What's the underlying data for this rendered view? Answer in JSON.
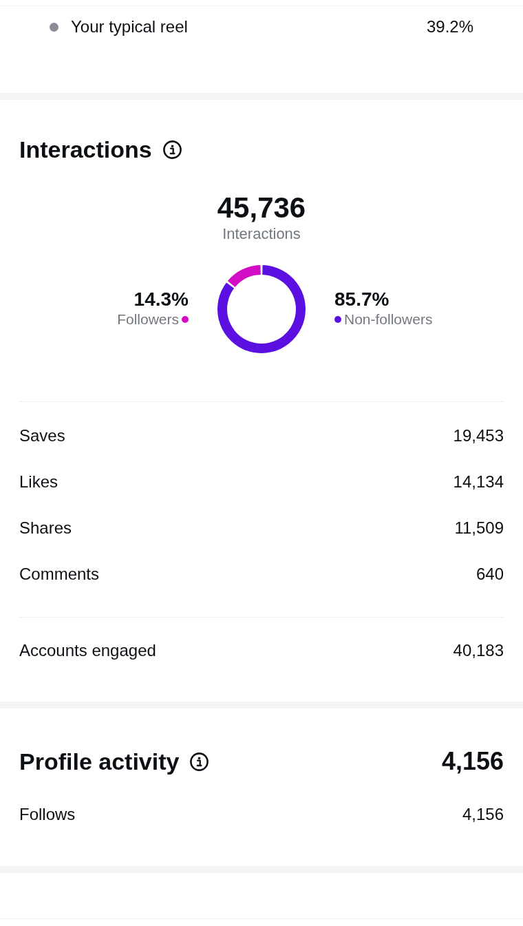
{
  "reel_comparison": {
    "label": "Your typical reel",
    "value": "39.2%",
    "color": "#8a8c95"
  },
  "interactions": {
    "title": "Interactions",
    "total": "45,736",
    "total_label": "Interactions",
    "legend": [
      {
        "value": "14.3%",
        "color": "#d20dc5"
      },
      {
        "value": "85.7%",
        "color": "#5b0fe0"
      }
    ],
    "chart_data": {
      "type": "donut",
      "categories": [
        "Followers",
        "Non-followers"
      ],
      "values": [
        14.3,
        85.7
      ]
    },
    "metrics": [
      {
        "label": "Saves",
        "value": "19,453"
      },
      {
        "label": "Likes",
        "value": "14,134"
      },
      {
        "label": "Shares",
        "value": "11,509"
      },
      {
        "label": "Comments",
        "value": "640"
      }
    ],
    "accounts_engaged": {
      "label": "Accounts engaged",
      "value": "40,183"
    }
  },
  "profile_activity": {
    "title": "Profile activity",
    "value": "4,156",
    "rows": [
      {
        "label": "Follows",
        "value": "4,156"
      }
    ]
  }
}
